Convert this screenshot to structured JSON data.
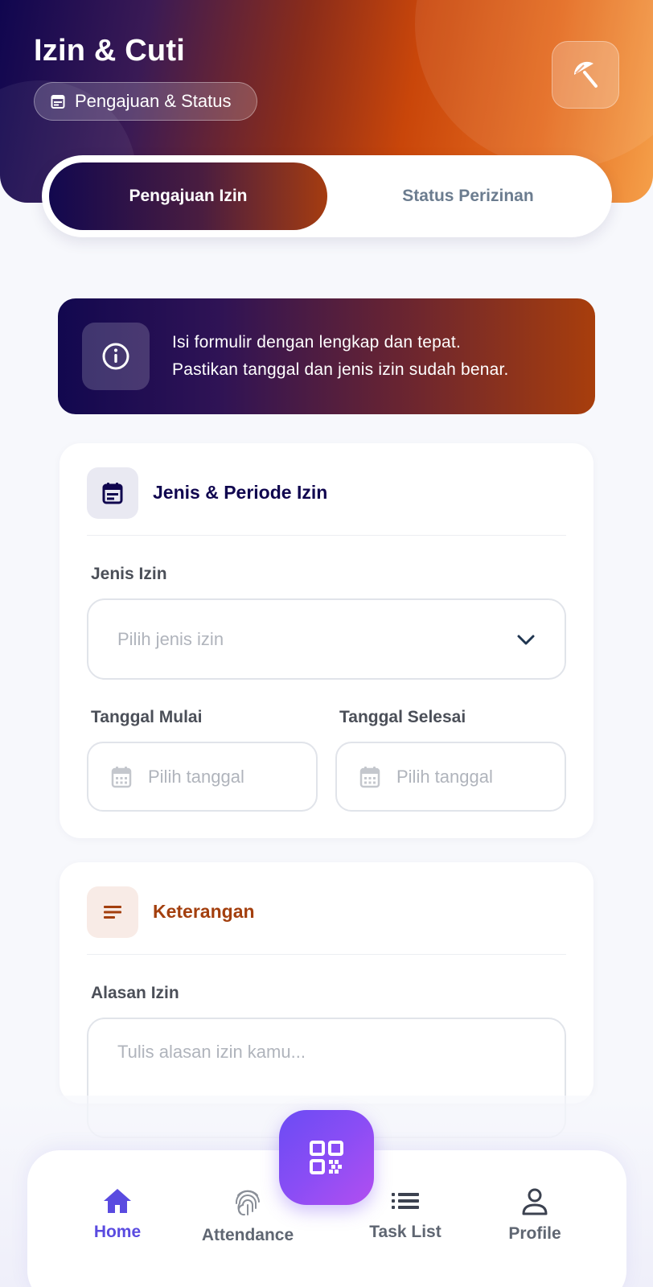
{
  "header": {
    "title": "Izin & Cuti",
    "subtitle": "Pengajuan & Status",
    "action_icon": "beach-umbrella-icon"
  },
  "tabs": [
    {
      "label": "Pengajuan Izin",
      "active": true
    },
    {
      "label": "Status Perizinan",
      "active": false
    }
  ],
  "info_banner": {
    "line1": "Isi formulir dengan lengkap dan tepat.",
    "line2": "Pastikan tanggal dan jenis izin sudah benar."
  },
  "section_period": {
    "title": "Jenis & Periode Izin",
    "title_color": "#10064f",
    "leave_type": {
      "label": "Jenis Izin",
      "placeholder": "Pilih jenis izin"
    },
    "start_date": {
      "label": "Tanggal Mulai",
      "placeholder": "Pilih tanggal"
    },
    "end_date": {
      "label": "Tanggal Selesai",
      "placeholder": "Pilih tanggal"
    }
  },
  "section_notes": {
    "title": "Keterangan",
    "title_color": "#a33f0e",
    "reason": {
      "label": "Alasan Izin",
      "placeholder": "Tulis alasan izin kamu..."
    }
  },
  "bottom_nav": {
    "items": [
      {
        "label": "Home",
        "icon": "home-icon",
        "active": true
      },
      {
        "label": "Attendance",
        "icon": "fingerprint-icon",
        "active": false
      },
      {
        "label": "Task List",
        "icon": "list-icon",
        "active": false
      },
      {
        "label": "Profile",
        "icon": "user-icon",
        "active": false
      }
    ],
    "fab_icon": "qr-code-icon"
  },
  "colors": {
    "primary_dark": "#10064f",
    "accent_orange": "#c9460a",
    "nav_active": "#5a4be0",
    "fab": "#8a4df5"
  }
}
